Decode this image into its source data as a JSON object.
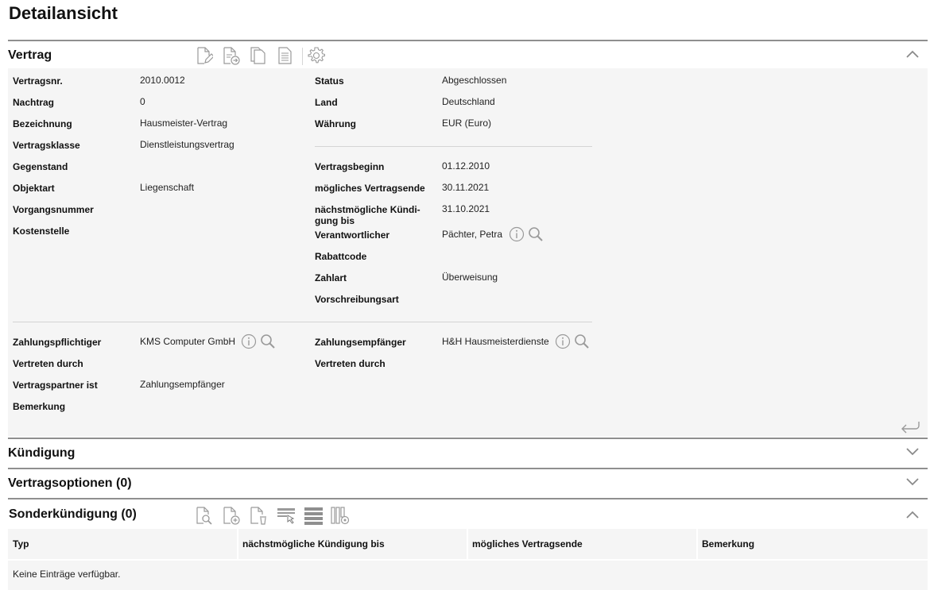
{
  "page": {
    "title": "Detailansicht"
  },
  "vertrag": {
    "title": "Vertrag",
    "left_fields": [
      {
        "label": "Vertragsnr.",
        "value": "2010.0012"
      },
      {
        "label": "Nachtrag",
        "value": "0"
      },
      {
        "label": "Bezeichnung",
        "value": "Hausmeister-Vertrag"
      },
      {
        "label": "Vertragsklasse",
        "value": "Dienstleistungsvertrag"
      },
      {
        "label": "Gegenstand",
        "value": ""
      },
      {
        "label": "Objektart",
        "value": "Liegenschaft"
      },
      {
        "label": "Vorgangsnummer",
        "value": ""
      },
      {
        "label": "Kostenstelle",
        "value": ""
      }
    ],
    "right_fields_top": [
      {
        "label": "Status",
        "value": "Abgeschlossen"
      },
      {
        "label": "Land",
        "value": "Deutschland"
      },
      {
        "label": "Währung",
        "value": "EUR (Euro)"
      }
    ],
    "right_fields_dates": [
      {
        "label": "Vertragsbeginn",
        "value": "01.12.2010"
      },
      {
        "label": "mögliches Vertragsende",
        "value": "30.11.2021"
      },
      {
        "label": "nächstmögliche Kündi-",
        "label2": "gung bis",
        "value": "31.10.2021"
      },
      {
        "label": "Verantwortlicher",
        "value": "Pächter, Petra"
      },
      {
        "label": "Rabattcode",
        "value": ""
      },
      {
        "label": "Zahlart",
        "value": "Überweisung"
      },
      {
        "label": "Vorschreibungsart",
        "value": ""
      }
    ],
    "payment_left": [
      {
        "label": "Zahlungspflichtiger",
        "value": "KMS Computer GmbH"
      },
      {
        "label": "Vertreten durch",
        "value": ""
      },
      {
        "label": "Vertragspartner ist",
        "value": "Zahlungsempfänger"
      },
      {
        "label": "Bemerkung",
        "value": ""
      }
    ],
    "payment_right": [
      {
        "label": "Zahlungsempfänger",
        "value": "H&H Hausmeisterdienste"
      },
      {
        "label": "Vertreten durch",
        "value": ""
      }
    ],
    "toolbar_icons": [
      "edit-document-icon",
      "export-document-icon",
      "copy-document-icon",
      "document-icon",
      "gear-icon"
    ]
  },
  "sections": {
    "kuendigung": {
      "title": "Kündigung"
    },
    "vertragsoptionen": {
      "title": "Vertragsoptionen (0)"
    },
    "sonderkuendigung": {
      "title": "Sonderkündigung (0)",
      "columns": [
        "Typ",
        "nächstmögliche Kündigung bis",
        "mögliches Vertragsende",
        "Bemerkung"
      ],
      "empty_message": "Keine Einträge verfügbar."
    }
  },
  "colors": {
    "header_border": "#8f8f8f",
    "panel_bg": "#f5f5f5",
    "icon": "#9a9a9a"
  }
}
